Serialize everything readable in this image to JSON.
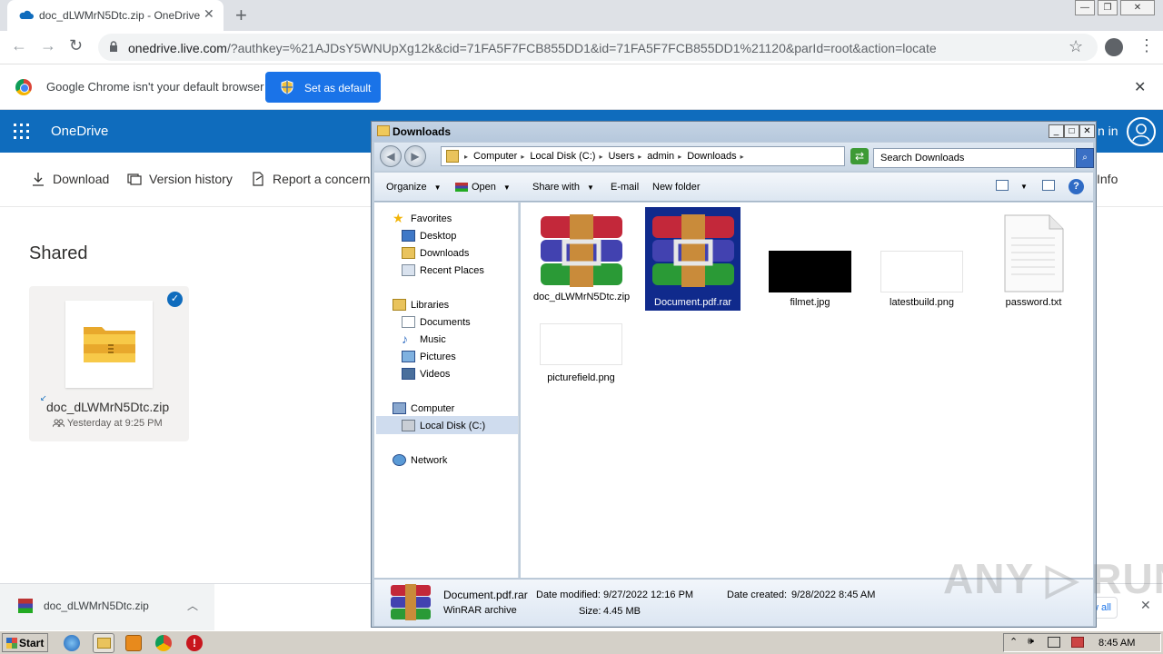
{
  "browser": {
    "tab_title": "doc_dLWMrN5Dtc.zip - OneDrive",
    "url_host": "onedrive.live.com",
    "url_rest": "/?authkey=%21AJDsY5WNUpXg12k&cid=71FA5F7FCB855DD1&id=71FA5F7FCB855DD1%21120&parId=root&action=locate",
    "infobar_text": "Google Chrome isn't your default browser",
    "set_default_label": "Set as default"
  },
  "onedrive": {
    "title": "OneDrive",
    "signin": "n in",
    "commands": [
      {
        "label": "Download",
        "icon": "download-icon"
      },
      {
        "label": "Version history",
        "icon": "history-icon"
      },
      {
        "label": "Report a concern",
        "icon": "report-icon"
      }
    ],
    "info_label": "Info",
    "section_title": "Shared",
    "file_card": {
      "name": "doc_dLWMrN5Dtc.zip",
      "date": "Yesterday at 9:25 PM"
    }
  },
  "download_shelf": {
    "file": "doc_dLWMrN5Dtc.zip",
    "show_all": "w all"
  },
  "explorer": {
    "title": "Downloads",
    "breadcrumbs": [
      "Computer",
      "Local Disk (C:)",
      "Users",
      "admin",
      "Downloads"
    ],
    "search_placeholder": "Search Downloads",
    "commands": {
      "organize": "Organize",
      "open": "Open",
      "share_with": "Share with",
      "email": "E-mail",
      "new_folder": "New folder"
    },
    "nav": {
      "favorites": "Favorites",
      "desktop": "Desktop",
      "downloads": "Downloads",
      "recent": "Recent Places",
      "libraries": "Libraries",
      "documents": "Documents",
      "music": "Music",
      "pictures": "Pictures",
      "videos": "Videos",
      "computer": "Computer",
      "local_disk": "Local Disk (C:)",
      "network": "Network"
    },
    "files": [
      {
        "name": "doc_dLWMrN5Dtc.zip",
        "kind": "winrar-icon"
      },
      {
        "name": "Document.pdf.rar",
        "kind": "winrar-icon",
        "selected": true
      },
      {
        "name": "filmet.jpg",
        "kind": "image-thumbnail"
      },
      {
        "name": "latestbuild.png",
        "kind": "image-thumbnail"
      },
      {
        "name": "password.txt",
        "kind": "text-file-icon"
      },
      {
        "name": "picturefield.png",
        "kind": "image-thumbnail"
      }
    ],
    "details": {
      "name": "Document.pdf.rar",
      "type": "WinRAR archive",
      "modified_label": "Date modified:",
      "modified": "9/27/2022 12:16 PM",
      "size_label": "Size:",
      "size": "4.45 MB",
      "created_label": "Date created:",
      "created": "9/28/2022 8:45 AM"
    }
  },
  "taskbar": {
    "start": "Start",
    "clock": "8:45 AM"
  },
  "watermark": "ANY RUN",
  "colors": {
    "onedrive_blue": "#0f6cbd",
    "chrome_blue": "#1a73e8",
    "selection": "#102a8c"
  }
}
